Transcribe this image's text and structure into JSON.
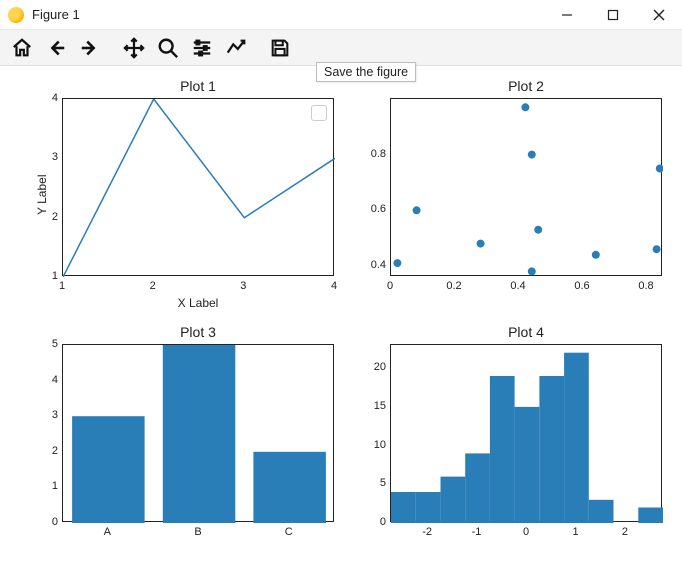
{
  "window": {
    "title": "Figure 1"
  },
  "toolbar": {
    "icons": [
      {
        "name": "home-icon"
      },
      {
        "name": "back-icon"
      },
      {
        "name": "forward-icon"
      },
      {
        "name": "pan-icon"
      },
      {
        "name": "zoom-icon"
      },
      {
        "name": "configure-icon"
      },
      {
        "name": "edit-icon"
      },
      {
        "name": "save-icon"
      }
    ],
    "tooltip": "Save the figure"
  },
  "chart_data": [
    {
      "type": "line",
      "title": "Plot 1",
      "xlabel": "X Label",
      "ylabel": "Y Label",
      "x": [
        1,
        2,
        3,
        4
      ],
      "y": [
        1,
        4,
        2,
        3
      ],
      "xlim": [
        1,
        4
      ],
      "ylim": [
        1,
        4
      ],
      "xticks": [
        1,
        2,
        3,
        4
      ],
      "yticks": [
        1,
        2,
        3,
        4
      ],
      "legend_box": true
    },
    {
      "type": "scatter",
      "title": "Plot 2",
      "x": [
        0.02,
        0.08,
        0.28,
        0.42,
        0.44,
        0.44,
        0.46,
        0.64,
        0.83,
        0.84
      ],
      "y": [
        0.41,
        0.6,
        0.48,
        0.97,
        0.38,
        0.8,
        0.53,
        0.44,
        0.46,
        0.75
      ],
      "xlim": [
        0.0,
        0.85
      ],
      "ylim": [
        0.36,
        1.0
      ],
      "xticks": [
        0.0,
        0.2,
        0.4,
        0.6,
        0.8
      ],
      "yticks": [
        0.4,
        0.6,
        0.8
      ]
    },
    {
      "type": "bar",
      "title": "Plot 3",
      "categories": [
        "A",
        "B",
        "C"
      ],
      "values": [
        3,
        5,
        2
      ],
      "ylim": [
        0,
        5
      ],
      "yticks": [
        0,
        1,
        2,
        3,
        4,
        5
      ]
    },
    {
      "type": "bar",
      "title": "Plot 4",
      "note": "histogram counts per bin",
      "bin_edges": [
        -2.75,
        -2.25,
        -1.75,
        -1.25,
        -0.75,
        -0.25,
        0.25,
        0.75,
        1.25,
        1.75,
        2.25,
        2.75
      ],
      "counts": [
        4,
        4,
        6,
        9,
        19,
        15,
        19,
        22,
        3,
        0,
        2
      ],
      "xlim": [
        -2.75,
        2.75
      ],
      "ylim": [
        0,
        23
      ],
      "xticks": [
        -2,
        -1,
        0,
        1,
        2
      ],
      "yticks": [
        0,
        5,
        10,
        15,
        20
      ]
    }
  ]
}
